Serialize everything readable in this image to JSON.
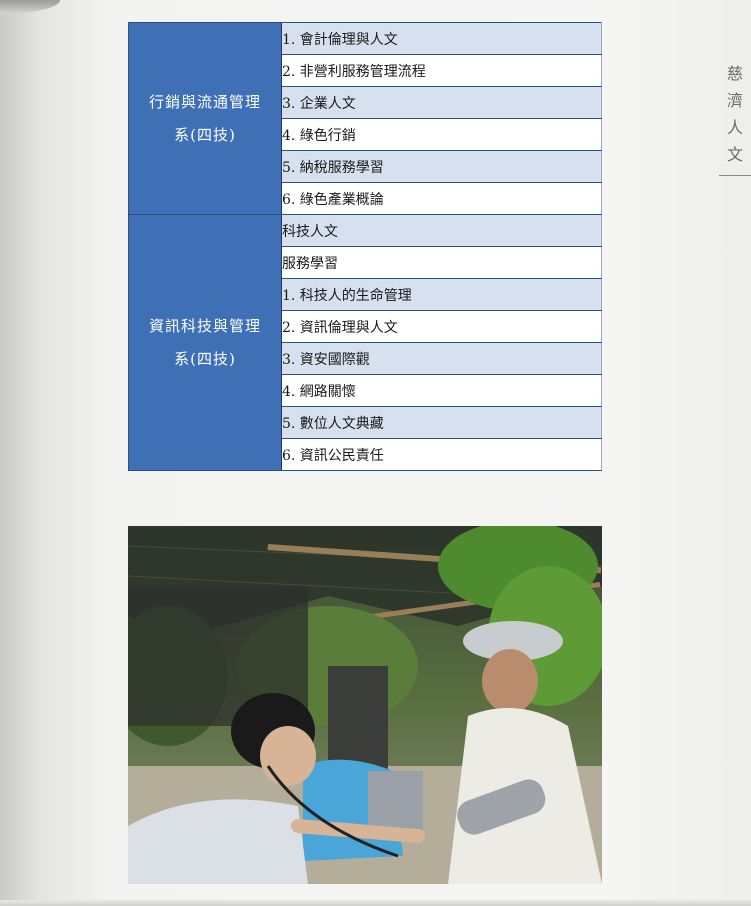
{
  "side_tab": {
    "chars": [
      "慈",
      "濟",
      "人",
      "文"
    ]
  },
  "departments": [
    {
      "name_line1": "行銷與流通管理",
      "name_line2": "系(四技)",
      "courses": [
        "1. 會計倫理與人文",
        "2. 非營利服務管理流程",
        "3. 企業人文",
        "4. 綠色行銷",
        "5. 納稅服務學習",
        "6. 綠色產業概論"
      ]
    },
    {
      "name_line1": "資訊科技與管理",
      "name_line2": "系(四技)",
      "courses": [
        "科技人文",
        "服務學習",
        "1. 科技人的生命管理",
        "2. 資訊倫理與人文",
        "3. 資安國際觀",
        "4. 網路關懷",
        "5. 數位人文典藏",
        "6. 資訊公民責任"
      ]
    }
  ],
  "colors": {
    "dept_bg": "#3f70b6",
    "row_shaded": "#d7e0ee",
    "row_plain": "#ffffff"
  },
  "photo": {
    "description_icon": "photo-student-measuring-blood-pressure"
  }
}
